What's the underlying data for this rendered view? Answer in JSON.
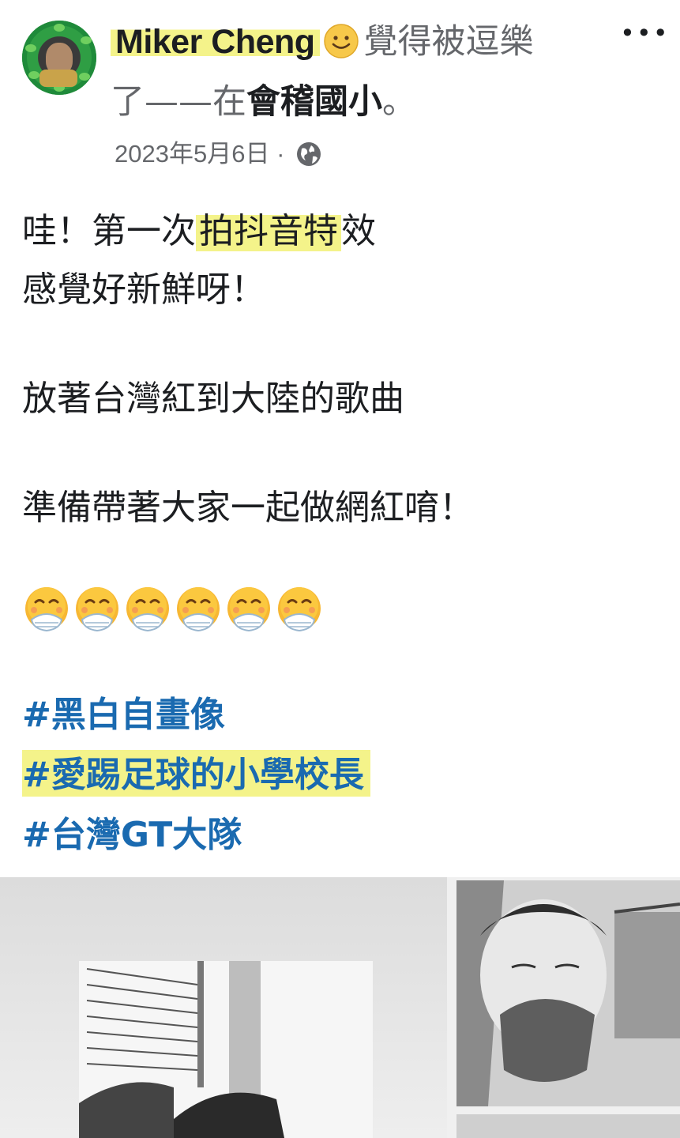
{
  "post": {
    "author": "Miker Cheng",
    "feeling_text": "覺得被逗樂",
    "feeling_text_cont": "了——在",
    "location": "會稽國小",
    "location_suffix": "。",
    "date": "2023年5月6日",
    "date_separator": "·",
    "privacy_icon": "globe-icon",
    "more_menu": "•••",
    "text_lines": {
      "l1_pre": "哇！第一次",
      "l1_hl": "拍抖音特",
      "l1_post": "效",
      "l2": "感覺好新鮮呀！",
      "l3": "放著台灣紅到大陸的歌曲",
      "l4": "準備帶著大家一起做網紅唷！"
    },
    "emoji": "face-with-hand-over-mouth",
    "emoji_count": 6,
    "hashtags": [
      "#黑白自畫像",
      "#愛踢足球的小學校長",
      "#台灣GT大隊"
    ]
  },
  "colors": {
    "highlight": "#f4f38a",
    "hashtag": "#1a6ab0",
    "secondary_text": "#65676b",
    "primary_text": "#1c1e21"
  }
}
